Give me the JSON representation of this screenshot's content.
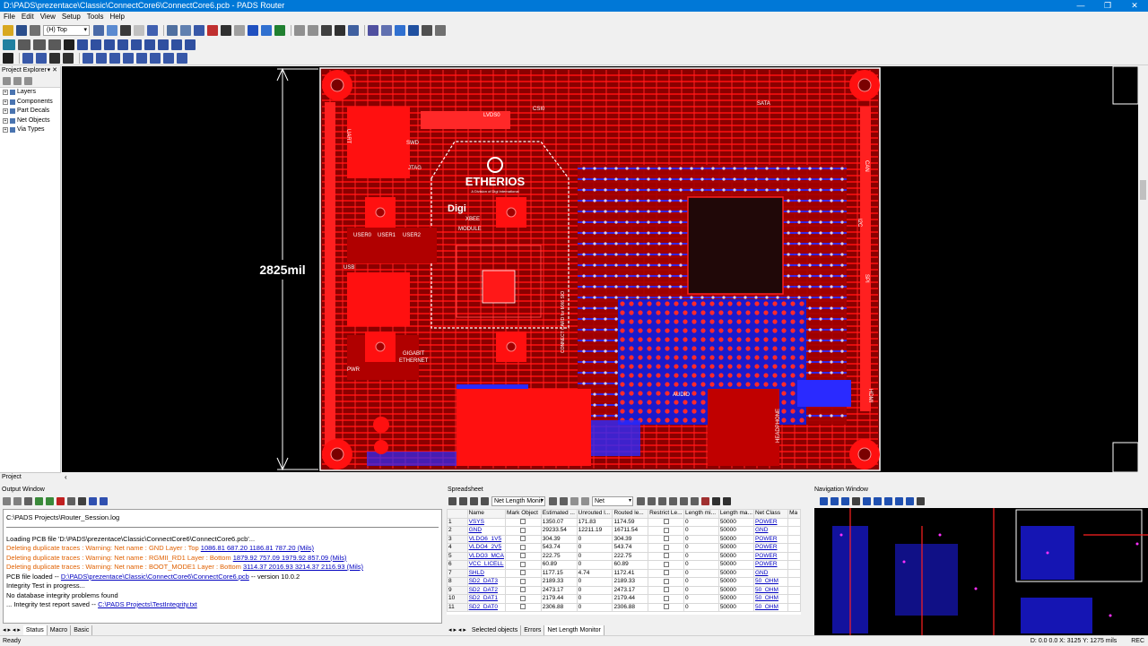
{
  "window": {
    "title": "D:\\PADS\\prezentace\\Classic\\ConnectCore6\\ConnectCore6.pcb - PADS Router",
    "controls": [
      "—",
      "❐",
      "✕"
    ]
  },
  "menu": [
    "File",
    "Edit",
    "View",
    "Setup",
    "Tools",
    "Help"
  ],
  "toolbar": {
    "layer_select": "(H) Top"
  },
  "project_explorer": {
    "title": "Project Explorer",
    "items": [
      "Layers",
      "Components",
      "Part Decals",
      "Net Objects",
      "Via Types"
    ],
    "tab": "Project"
  },
  "pcb": {
    "dimension": "2825mil",
    "labels": [
      "ETHERIOS",
      "A Division of Digi International",
      "Digi",
      "XBEE",
      "MODULE",
      "USER0",
      "USER1",
      "USER2",
      "GIGABIT",
      "ETHERNET",
      "HEADPHONE",
      "LVDS0",
      "CSI0",
      "SATA",
      "CAN",
      "SPI",
      "UART",
      "JTAG",
      "SWD",
      "USB",
      "AUDIO",
      "CONNECT CARD for MX6 SIO",
      "I2C",
      "PWR",
      "HDMI"
    ]
  },
  "output_window": {
    "title": "Output Window",
    "log_path": "C:\\PADS Projects\\Router_Session.log",
    "lines": [
      {
        "text": "Loading PCB file 'D:\\PADS\\prezentace\\Classic\\ConnectCore6\\ConnectCore6.pcb'...",
        "kind": "normal"
      },
      {
        "text": "Deleting duplicate traces : Warning: Net name : GND Layer : Top ",
        "link": "1086.81 687.20 1186.81 787.20 (Mils)",
        "kind": "warn"
      },
      {
        "text": "Deleting duplicate traces : Warning: Net name : RGMII_RD1 Layer : Bottom ",
        "link": "1879.92 757.09 1979.92 857.09 (Mils)",
        "kind": "warn"
      },
      {
        "text": "Deleting duplicate traces : Warning: Net name : BOOT_MODE1 Layer : Bottom ",
        "link": "3114.37 2016.93 3214.37 2116.93 (Mils)",
        "kind": "warn"
      },
      {
        "text": "PCB file loaded -- ",
        "link": "D:\\PADS\\prezentace\\Classic\\ConnectCore6\\ConnectCore6.pcb",
        "suffix": " -- version 10.0.2",
        "kind": "normal"
      },
      {
        "text": "Integrity Test in progress...",
        "kind": "normal"
      },
      {
        "text": "No database integrity problems found",
        "kind": "normal"
      },
      {
        "text": "... Integrity test report saved -- ",
        "link": "C:\\PADS Projects\\TestIntegrity.txt",
        "kind": "normal"
      }
    ],
    "tabs": [
      "Status",
      "Macro",
      "Basic"
    ]
  },
  "spreadsheet": {
    "title": "Spreadsheet",
    "view_select": "Net Length Monit",
    "filter_select": "Net",
    "columns": [
      "Name",
      "Mark Object",
      "Estimated ...",
      "Unrouted l...",
      "Routed le...",
      "Restrict Le...",
      "Length mi...",
      "Length ma...",
      "Net Class",
      "Ma"
    ],
    "rows": [
      [
        "1",
        "VSYS",
        "1350.07",
        "171.83",
        "1174.59",
        "0",
        "50000",
        "POWER"
      ],
      [
        "2",
        "GND",
        "29233.54",
        "12211.19",
        "16711.54",
        "0",
        "50000",
        "GND"
      ],
      [
        "3",
        "VLDO6_1V5",
        "304.39",
        "0",
        "304.39",
        "0",
        "50000",
        "POWER"
      ],
      [
        "4",
        "VLDO4_2V5",
        "543.74",
        "0",
        "543.74",
        "0",
        "50000",
        "POWER"
      ],
      [
        "5",
        "VLDO3_MCA",
        "222.75",
        "0",
        "222.75",
        "0",
        "50000",
        "POWER"
      ],
      [
        "6",
        "VCC_LICELL",
        "60.89",
        "0",
        "60.89",
        "0",
        "50000",
        "POWER"
      ],
      [
        "7",
        "SHLD",
        "1177.15",
        "4.74",
        "1172.41",
        "0",
        "50000",
        "GND"
      ],
      [
        "8",
        "SD2_DAT3",
        "2189.33",
        "0",
        "2189.33",
        "0",
        "50000",
        "50_OHM"
      ],
      [
        "9",
        "SD2_DAT2",
        "2473.17",
        "0",
        "2473.17",
        "0",
        "50000",
        "50_OHM"
      ],
      [
        "10",
        "SD2_DAT1",
        "2179.44",
        "0",
        "2179.44",
        "0",
        "50000",
        "50_OHM"
      ],
      [
        "11",
        "SD2_DAT0",
        "2306.88",
        "0",
        "2306.88",
        "0",
        "50000",
        "50_OHM"
      ]
    ],
    "tabs": [
      "Selected objects",
      "Errors",
      "Net Length Monitor"
    ]
  },
  "navigation_window": {
    "title": "Navigation Window"
  },
  "status": {
    "left": "Ready",
    "coords": "D: 0.0 0.0  X: 3125   Y: 1275  mils",
    "mode": "REC"
  }
}
